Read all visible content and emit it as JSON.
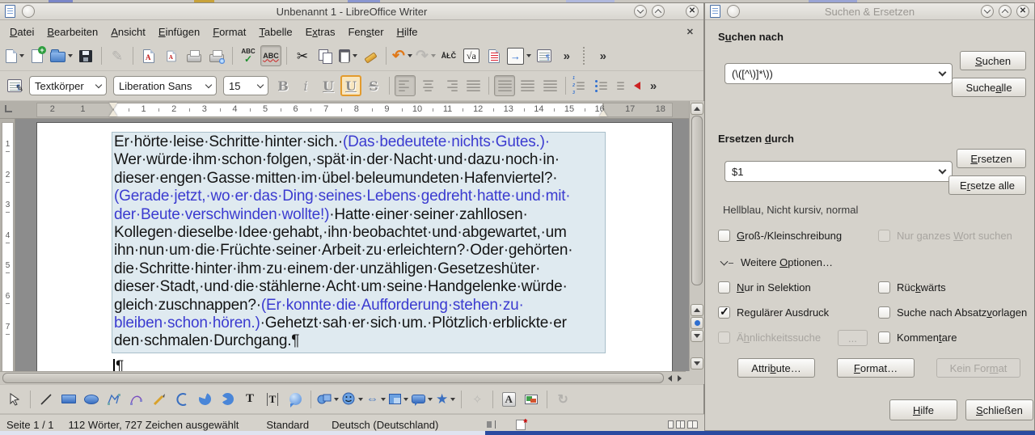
{
  "window": {
    "title": "Unbenannt 1 - LibreOffice Writer"
  },
  "menu": {
    "items": [
      {
        "name": "menu-datei",
        "label": "[D]atei"
      },
      {
        "name": "menu-bearbeiten",
        "label": "[B]earbeiten"
      },
      {
        "name": "menu-ansicht",
        "label": "[A]nsicht"
      },
      {
        "name": "menu-einfuegen",
        "label": "[E]infügen"
      },
      {
        "name": "menu-format",
        "label": "[F]ormat"
      },
      {
        "name": "menu-tabelle",
        "label": "[T]abelle"
      },
      {
        "name": "menu-extras",
        "label": "E[x]tras"
      },
      {
        "name": "menu-fenster",
        "label": "Fen[s]ter"
      },
      {
        "name": "menu-hilfe",
        "label": "[H]ilfe"
      }
    ]
  },
  "toolbar_standard": {
    "items": [
      {
        "name": "new-document-icon",
        "icon": "doc",
        "drop": true
      },
      {
        "name": "new-from-template-icon",
        "icon": "docplus"
      },
      {
        "name": "open-icon",
        "icon": "folder",
        "drop": true
      },
      {
        "name": "save-icon",
        "icon": "save"
      },
      {
        "sep": true
      },
      {
        "name": "edit-mode-icon",
        "icon": "pencil",
        "disabled": true
      },
      {
        "sep": true
      },
      {
        "name": "export-pdf-icon",
        "icon": "pdf"
      },
      {
        "name": "export-pdf-direct-icon",
        "icon": "pdfsm"
      },
      {
        "name": "print-icon",
        "icon": "print"
      },
      {
        "name": "print-preview-icon",
        "icon": "printeye"
      },
      {
        "sep": true
      },
      {
        "name": "spelling-icon",
        "icon": "abcchk"
      },
      {
        "name": "auto-spellcheck-icon",
        "icon": "abcwave",
        "pressed": true
      },
      {
        "sep": true
      },
      {
        "name": "cut-icon",
        "icon": "cut"
      },
      {
        "name": "copy-icon",
        "icon": "copy"
      },
      {
        "name": "paste-icon",
        "icon": "paste",
        "drop": true
      },
      {
        "name": "clone-formatting-icon",
        "icon": "brush"
      },
      {
        "sep": true
      },
      {
        "name": "undo-icon",
        "icon": "undo",
        "drop": true
      },
      {
        "name": "redo-icon",
        "icon": "redo",
        "drop": true,
        "disabled": true
      },
      {
        "name": "special-character-icon",
        "icon": "chars"
      },
      {
        "name": "insert-formula-icon",
        "icon": "formula"
      },
      {
        "name": "track-changes-icon",
        "icon": "track"
      },
      {
        "name": "navigator-icon",
        "icon": "nav",
        "drop": true
      },
      {
        "name": "formatting-marks-icon",
        "icon": "marks"
      },
      {
        "name": "toolbar-overflow-icon",
        "icon": "ov"
      },
      {
        "grip": true
      },
      {
        "name": "find-toolbar-overflow-icon",
        "icon": "ov"
      }
    ],
    "glyphs": {
      "cut": "✂",
      "undo": "↶",
      "redo": "↷",
      "chars": "ÅŁČ",
      "formula": "√a",
      "nav": "→",
      "ov": "»",
      "pencil": "✎",
      "abc": "ABC",
      "abc_check": "✓"
    }
  },
  "toolbar_formatting": {
    "paragraph_style": "Textkörper",
    "font_name": "Liberation Sans",
    "font_size": "15",
    "letters": {
      "bold": "B",
      "italic": "i",
      "underline": "U",
      "underline_active": "U",
      "strikethrough": "S"
    },
    "items": [
      {
        "name": "format-paragraph-style-icon",
        "icon": "parastyle"
      },
      {
        "select": "style"
      },
      {
        "select": "font"
      },
      {
        "select": "size"
      },
      {
        "name": "bold-icon",
        "icon": "B"
      },
      {
        "name": "italic-icon",
        "icon": "I"
      },
      {
        "name": "underline-icon",
        "icon": "U"
      },
      {
        "name": "underline-active-icon",
        "icon": "U",
        "hl": true
      },
      {
        "name": "strikethrough-icon",
        "icon": "S"
      },
      {
        "sep": true
      },
      {
        "name": "align-left-icon",
        "icon": "al",
        "pressed": true
      },
      {
        "name": "align-center-icon",
        "icon": "ac"
      },
      {
        "name": "align-right-icon",
        "icon": "ar"
      },
      {
        "name": "justify-icon",
        "icon": "aj"
      },
      {
        "sep": true
      },
      {
        "name": "line-spacing-1-icon",
        "icon": "ls",
        "pressed": true
      },
      {
        "name": "line-spacing-15-icon",
        "icon": "ls"
      },
      {
        "name": "line-spacing-2-icon",
        "icon": "ls"
      },
      {
        "sep": true
      },
      {
        "name": "ordered-list-icon",
        "icon": "numlist"
      },
      {
        "name": "unordered-list-icon",
        "icon": "bullist"
      },
      {
        "name": "decrease-indent-icon",
        "icon": "indent"
      },
      {
        "name": "formatting-overflow-icon",
        "icon": "ov"
      }
    ]
  },
  "ruler": {
    "left_numbers": [
      "2",
      "1"
    ],
    "white_numbers": [
      "1",
      "2",
      "3",
      "4",
      "5",
      "6",
      "7",
      "8",
      "9",
      "10",
      "11",
      "12",
      "13",
      "14",
      "15",
      "16"
    ],
    "right_numbers": [
      "17",
      "18"
    ],
    "vertical_numbers": [
      "1",
      "2",
      "3",
      "4",
      "5",
      "6",
      "7"
    ]
  },
  "document": {
    "lines": [
      [
        {
          "t": "Er·hörte·leise·Schritte·hinter·sich.·"
        },
        {
          "t": "(Das·bedeutete·nichts·Gutes.)·",
          "c": "u"
        }
      ],
      [
        {
          "t": "Wer·würde·ihm·schon·folgen,·spät·in·der·Nacht·und·dazu·noch·in·"
        }
      ],
      [
        {
          "t": "dieser·engen·Gasse·mitten·im·übel·beleumundeten·Hafenviertel?·"
        }
      ],
      [
        {
          "t": "(Gerade·jetzt,·wo·er·das·Ding·seines·Lebens·gedreht·hatte·und·mit·",
          "c": "u"
        }
      ],
      [
        {
          "t": "der·Beute·verschwinden·wollte!)",
          "c": "u"
        },
        {
          "t": "·Hatte·einer·seiner·zahllosen·"
        }
      ],
      [
        {
          "t": "Kollegen·dieselbe·Idee·gehabt,·ihn·beobachtet·und·abgewartet,·um"
        }
      ],
      [
        {
          "t": "ihn·nun·um·die·Früchte·seiner·Arbeit·zu·erleichtern?·Oder·gehörten·"
        }
      ],
      [
        {
          "t": "die·Schritte·hinter·ihm·zu·einem·der·unzähligen·Gesetzeshüter·"
        }
      ],
      [
        {
          "t": "dieser·Stadt,·und·die·stählerne·Acht·um·seine·Handgelenke·würde·"
        }
      ],
      [
        {
          "t": "gleich·zuschnappen?·"
        },
        {
          "t": "(Er·konnte·die·Aufforderung·stehen·zu·",
          "c": "u"
        }
      ],
      [
        {
          "t": "bleiben·schon·hören.)",
          "c": "u"
        },
        {
          "t": "·Gehetzt·sah·er·sich·um.·Plötzlich·erblickte·er"
        }
      ],
      [
        {
          "t": "den·schmalen·Durchgang.¶"
        }
      ]
    ],
    "after_text": "¶"
  },
  "toolbar_drawing": {
    "items": [
      {
        "name": "select-icon",
        "icon": "dselect"
      },
      {
        "sep": true
      },
      {
        "name": "insert-line-icon",
        "icon": "dline"
      },
      {
        "name": "rectangle-icon",
        "icon": "drect"
      },
      {
        "name": "ellipse-icon",
        "icon": "dellipse"
      },
      {
        "name": "polygon-icon",
        "icon": "dpoly"
      },
      {
        "name": "curve-icon",
        "icon": "dcurve"
      },
      {
        "name": "freeform-line-icon",
        "icon": "dfree"
      },
      {
        "name": "arc-icon",
        "icon": "darc"
      },
      {
        "name": "circle-pie-icon",
        "icon": "dpie"
      },
      {
        "name": "circle-segment-icon",
        "icon": "dseg"
      },
      {
        "name": "text-box-icon",
        "icon": "dT"
      },
      {
        "name": "vertical-text-icon",
        "icon": "dvT"
      },
      {
        "name": "callout-sphere-icon",
        "icon": "dsphere"
      },
      {
        "sep": true
      },
      {
        "name": "basic-shapes-icon",
        "icon": "dshapes",
        "drop": true
      },
      {
        "name": "symbol-shapes-icon",
        "icon": "dsmiley",
        "drop": true
      },
      {
        "name": "block-arrows-icon",
        "icon": "darrows",
        "drop": true
      },
      {
        "name": "flowchart-icon",
        "icon": "dflow",
        "drop": true
      },
      {
        "name": "callouts-icon",
        "icon": "dcallout",
        "drop": true
      },
      {
        "name": "stars-icon",
        "icon": "dstar",
        "drop": true
      },
      {
        "sep": true
      },
      {
        "name": "edit-points-icon",
        "icon": "dpts",
        "disabled": true
      },
      {
        "sep": true
      },
      {
        "name": "fontwork-icon",
        "icon": "dA"
      },
      {
        "name": "insert-image-icon",
        "icon": "dimg"
      },
      {
        "sep": true
      },
      {
        "name": "rotate-icon",
        "icon": "drot",
        "disabled": true
      }
    ],
    "glyphs": {
      "arrows": "⇔",
      "star": "★",
      "rotate": "↻",
      "points": "✧",
      "T": "T"
    }
  },
  "statusbar": {
    "page": "Seite 1 / 1",
    "words": "112 Wörter, 727 Zeichen ausgewählt",
    "page_style": "Standard",
    "language": "Deutsch (Deutschland)"
  },
  "dialog": {
    "title": "Suchen & Ersetzen",
    "search_label": "S[u]chen nach",
    "search_value": "(\\([^\\)]*\\))",
    "find_button": "[S]uchen",
    "find_all_button": "Suche [a]lle",
    "replace_label": "Ersetzen [d]urch",
    "replace_value": "$1",
    "replace_button": "[E]rsetzen",
    "replace_all_button": "E[r]setze alle",
    "attribute_summary": "Hellblau, Nicht kursiv, normal",
    "more_options": "Weitere [O]ptionen…",
    "checks": [
      {
        "label": "[G]roß-/Kleinschreibung",
        "checked": false,
        "disabled": false
      },
      {
        "label": "Nur ganzes [W]ort suchen",
        "checked": false,
        "disabled": true
      },
      {
        "label": "[N]ur in Selektion",
        "checked": false,
        "disabled": false
      },
      {
        "label": "Rüc[k]wärts",
        "checked": false,
        "disabled": false
      },
      {
        "label": "Regulärer Ausdruck",
        "checked": true,
        "disabled": false
      },
      {
        "label": "Suche nach Absatz[v]orlagen",
        "checked": false,
        "disabled": false
      },
      {
        "label": "Ä[h]nlichkeitssuche",
        "checked": false,
        "disabled": true
      },
      {
        "label": "Kommen[t]are",
        "checked": false,
        "disabled": false
      }
    ],
    "similarity_button": "...",
    "attributes_button": "Attri[b]ute…",
    "format_button": "[F]ormat…",
    "no_format_button": "Kein For[m]at",
    "help_button": "[H]ilfe",
    "close_button": "[S]chließen"
  }
}
